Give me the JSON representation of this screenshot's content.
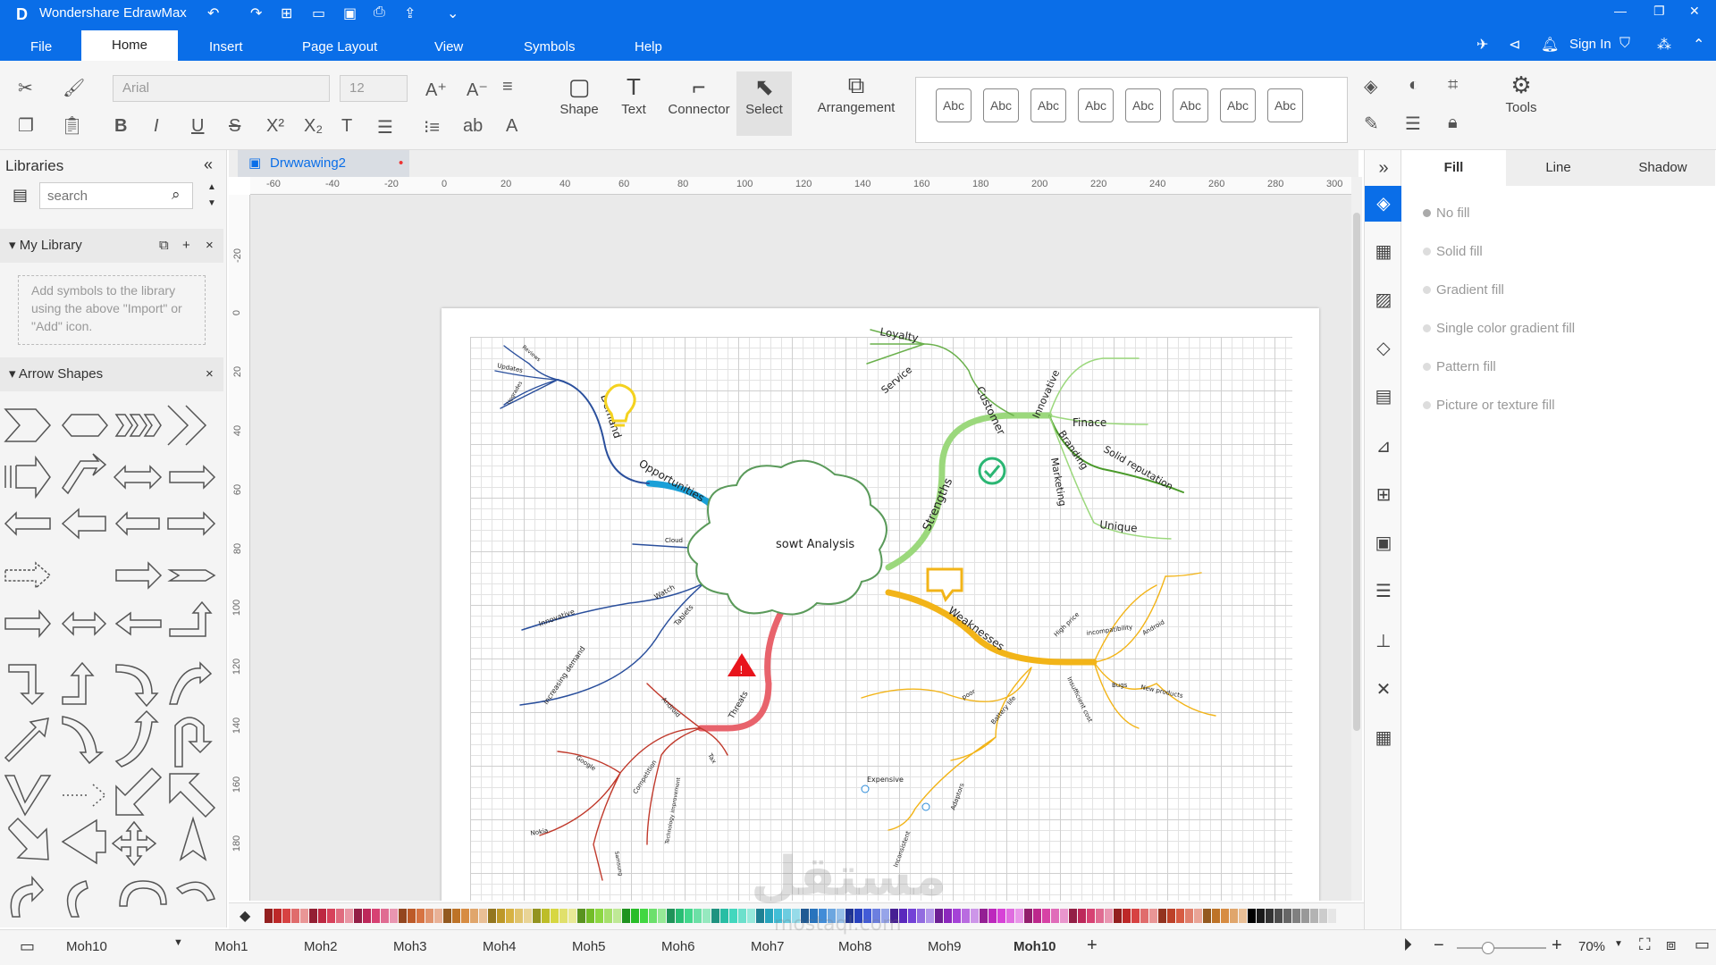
{
  "app": {
    "title": "Wondershare EdrawMax",
    "logo_glyph": "D",
    "sign_in": "Sign In"
  },
  "menu": {
    "items": [
      "File",
      "Home",
      "Insert",
      "Page Layout",
      "View",
      "Symbols",
      "Help"
    ],
    "active": "Home"
  },
  "ribbon": {
    "font_name": "Arial",
    "font_size": "12",
    "shape_label": "Shape",
    "text_label": "Text",
    "connector_label": "Connector",
    "select_label": "Select",
    "arrangement_label": "Arrangement",
    "style_samples": [
      "Abc",
      "Abc",
      "Abc",
      "Abc",
      "Abc",
      "Abc",
      "Abc",
      "Abc"
    ],
    "tools_label": "Tools"
  },
  "left_panel": {
    "title": "Libraries",
    "search_placeholder": "search",
    "my_library": {
      "title": "My Library",
      "hint": "Add symbols to the library using the above \"Import\" or \"Add\" icon."
    },
    "arrow_shapes": {
      "title": "Arrow Shapes"
    }
  },
  "document": {
    "tab_name": "Drwwawing2"
  },
  "ruler": {
    "h_ticks": [
      "-60",
      "-40",
      "-20",
      "0",
      "20",
      "40",
      "60",
      "80",
      "100",
      "120",
      "140",
      "160",
      "180",
      "200",
      "220",
      "240",
      "260",
      "280",
      "300"
    ],
    "v_ticks": [
      "-20",
      "0",
      "20",
      "40",
      "60",
      "80",
      "100",
      "120",
      "140",
      "160",
      "180"
    ]
  },
  "mindmap": {
    "center": "sowt Analysis",
    "branches": {
      "opportunities": "Opportunities",
      "strengths": "Strengths",
      "weaknesses": "Weaknesses",
      "threats": "Threats",
      "demand": "Demand",
      "customer": "Customer",
      "loyalty": "Loyalty",
      "service": "Service",
      "innovative": "Innovative",
      "finace": "Finace",
      "branding": "Branding",
      "solid_reputation": "Solid reputation",
      "marketing": "Marketing",
      "unique": "Unique",
      "cloud": "Cloud",
      "watch": "Watch",
      "tablets": "Tablets",
      "innovative_small": "Innovative",
      "increasing_demand": "increasing demand",
      "high_price": "High price",
      "incompatibility": "incompatibility",
      "android_w": "Android",
      "bugs": "Bugs",
      "new_products": "New products",
      "insufficient_cost": "Insufficient cost",
      "poor": "poor",
      "battery_life": "Battery life",
      "expensive": "Expensive",
      "adaptors": "Adaptors",
      "inconsistent": "Inconsistent",
      "android_t": "Android",
      "competition": "Competition",
      "google": "Google",
      "nokia": "Nokia",
      "samsung": "Samsung",
      "technology_improvement": "Technology improvement",
      "tax": "Tax",
      "upgrades": "Upgrades",
      "updates": "Updates",
      "reviews": "Reviews"
    }
  },
  "status": {
    "current_page": "Moh10",
    "pages": [
      "Moh1",
      "Moh2",
      "Moh3",
      "Moh4",
      "Moh5",
      "Moh6",
      "Moh7",
      "Moh8",
      "Moh9",
      "Moh10"
    ],
    "active_page": "Moh10",
    "zoom": "70%",
    "zoom_value": 0.7
  },
  "right_panel": {
    "tabs": [
      "Fill",
      "Line",
      "Shadow"
    ],
    "active_tab": "Fill",
    "fill_options": [
      "No fill",
      "Solid fill",
      "Gradient fill",
      "Single color gradient fill",
      "Pattern fill",
      "Picture or texture fill"
    ]
  },
  "watermark": {
    "arabic": "مستقل",
    "latin": "mostaql.com"
  },
  "colors": {
    "brand": "#0a6ee8",
    "opportunities": "#1aa0d8",
    "strengths": "#9bd87c",
    "weaknesses": "#f2b418",
    "threats": "#e8636c",
    "threats_dark": "#c0392b",
    "opp_dark": "#2a4f9c",
    "str_dark": "#4a9a2a"
  }
}
